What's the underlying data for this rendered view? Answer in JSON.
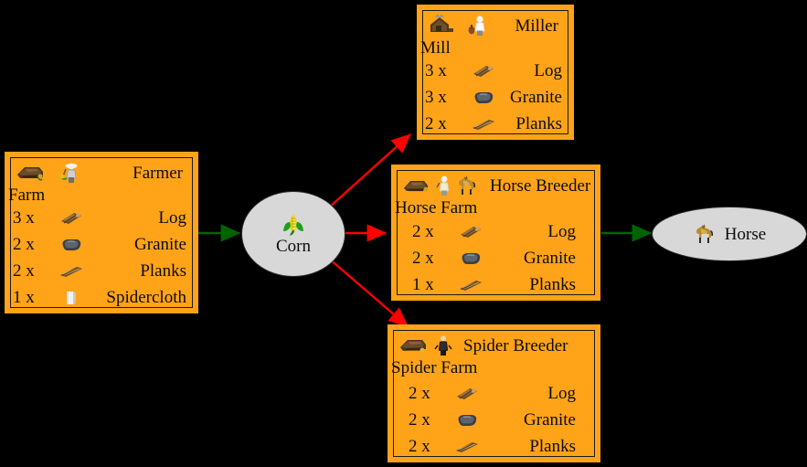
{
  "background_color": "#000000",
  "box_fill_color": "#ffa319",
  "ellipse_fill_color": "#d8d8d8",
  "edge_colors": {
    "supply": "#006400",
    "demand": "#ff0000"
  },
  "nodes": {
    "farm": {
      "building_title": "Farmer",
      "building_name": "Farm",
      "icons": [
        "farm-building-icon",
        "farmer-worker-icon"
      ],
      "costs": [
        {
          "qty": "3 x",
          "icon": "log-icon",
          "ware": "Log"
        },
        {
          "qty": "2 x",
          "icon": "granite-icon",
          "ware": "Granite"
        },
        {
          "qty": "2 x",
          "icon": "planks-icon",
          "ware": "Planks"
        },
        {
          "qty": "1 x",
          "icon": "spidercloth-icon",
          "ware": "Spidercloth"
        }
      ]
    },
    "mill": {
      "building_title": "Miller",
      "building_name": "Mill",
      "icons": [
        "mill-building-icon",
        "miller-worker-icon"
      ],
      "costs": [
        {
          "qty": "3 x",
          "icon": "log-icon",
          "ware": "Log"
        },
        {
          "qty": "3 x",
          "icon": "granite-icon",
          "ware": "Granite"
        },
        {
          "qty": "2 x",
          "icon": "planks-icon",
          "ware": "Planks"
        }
      ]
    },
    "horse_farm": {
      "building_title": "Horse Breeder",
      "building_name": "Horse Farm",
      "icons": [
        "horsefarm-building-icon",
        "horse-breeder-worker-icon",
        "horse-icon"
      ],
      "costs": [
        {
          "qty": "2 x",
          "icon": "log-icon",
          "ware": "Log"
        },
        {
          "qty": "2 x",
          "icon": "granite-icon",
          "ware": "Granite"
        },
        {
          "qty": "1 x",
          "icon": "planks-icon",
          "ware": "Planks"
        }
      ]
    },
    "spider_farm": {
      "building_title": "Spider Breeder",
      "building_name": "Spider Farm",
      "icons": [
        "spiderfarm-building-icon",
        "spider-breeder-worker-icon"
      ],
      "costs": [
        {
          "qty": "2 x",
          "icon": "log-icon",
          "ware": "Log"
        },
        {
          "qty": "2 x",
          "icon": "granite-icon",
          "ware": "Granite"
        },
        {
          "qty": "2 x",
          "icon": "planks-icon",
          "ware": "Planks"
        }
      ]
    },
    "corn": {
      "label": "Corn",
      "icon": "corn-icon"
    },
    "horse": {
      "label": "Horse",
      "icon": "horse-icon"
    }
  },
  "edges": [
    {
      "from": "Farm",
      "to": "Corn",
      "type": "produces",
      "color": "#006400"
    },
    {
      "from": "Corn",
      "to": "Mill",
      "type": "consumed-by",
      "color": "#ff0000"
    },
    {
      "from": "Corn",
      "to": "Horse Farm",
      "type": "consumed-by",
      "color": "#ff0000"
    },
    {
      "from": "Corn",
      "to": "Spider Farm",
      "type": "consumed-by",
      "color": "#ff0000"
    },
    {
      "from": "Horse Farm",
      "to": "Horse",
      "type": "produces",
      "color": "#006400"
    }
  ]
}
